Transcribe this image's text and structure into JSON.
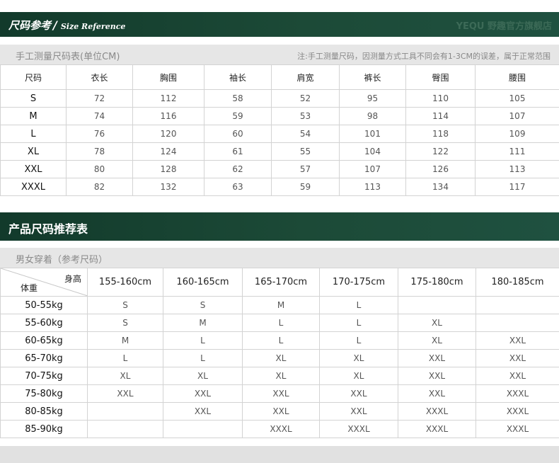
{
  "section1": {
    "title": "尺码参考",
    "slash": "/",
    "subtitle": "Size Reference",
    "watermark": "YEQU 野趣官方旗舰店",
    "table_title": "手工测量尺码表(单位CM)",
    "note": "注:手工测量尺码，因测量方式工具不同会有1-3CM的误差，属于正常范围",
    "headers": [
      "尺码",
      "衣长",
      "胸围",
      "袖长",
      "肩宽",
      "裤长",
      "臀围",
      "腰围"
    ],
    "rows": [
      [
        "S",
        "72",
        "112",
        "58",
        "52",
        "95",
        "110",
        "105"
      ],
      [
        "M",
        "74",
        "116",
        "59",
        "53",
        "98",
        "114",
        "107"
      ],
      [
        "L",
        "76",
        "120",
        "60",
        "54",
        "101",
        "118",
        "109"
      ],
      [
        "XL",
        "78",
        "124",
        "61",
        "55",
        "104",
        "122",
        "111"
      ],
      [
        "XXL",
        "80",
        "128",
        "62",
        "57",
        "107",
        "126",
        "113"
      ],
      [
        "XXXL",
        "82",
        "132",
        "63",
        "59",
        "113",
        "134",
        "117"
      ]
    ]
  },
  "section2": {
    "title": "产品尺码推荐表",
    "table_title": "男女穿着（参考尺码）",
    "corner_height": "身高",
    "corner_weight": "体重",
    "headers": [
      "155-160cm",
      "160-165cm",
      "165-170cm",
      "170-175cm",
      "175-180cm",
      "180-185cm"
    ],
    "rows": [
      [
        "50-55kg",
        "S",
        "S",
        "M",
        "L",
        "",
        ""
      ],
      [
        "55-60kg",
        "S",
        "M",
        "L",
        "L",
        "XL",
        ""
      ],
      [
        "60-65kg",
        "M",
        "L",
        "L",
        "L",
        "XL",
        "XXL"
      ],
      [
        "65-70kg",
        "L",
        "L",
        "XL",
        "XL",
        "XXL",
        "XXL"
      ],
      [
        "70-75kg",
        "XL",
        "XL",
        "XL",
        "XL",
        "XXL",
        "XXL"
      ],
      [
        "75-80kg",
        "XXL",
        "XXL",
        "XXL",
        "XXL",
        "XXL",
        "XXXL"
      ],
      [
        "80-85kg",
        "",
        "XXL",
        "XXL",
        "XXL",
        "XXXL",
        "XXXL"
      ],
      [
        "85-90kg",
        "",
        "",
        "XXXL",
        "XXXL",
        "XXXL",
        "XXXL"
      ]
    ]
  },
  "colors": {
    "banner": "#1c4a37",
    "subbar": "#e6e6e6",
    "border": "#d3d3d3"
  }
}
